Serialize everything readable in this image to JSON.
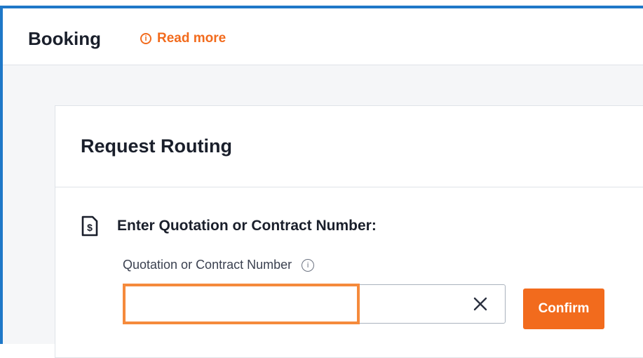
{
  "header": {
    "title": "Booking",
    "read_more_label": "Read more",
    "read_more_icon": "info-icon"
  },
  "card": {
    "title": "Request Routing",
    "section_icon": "document-dollar-icon",
    "section_label": "Enter Quotation or Contract Number:",
    "field": {
      "label": "Quotation or Contract Number",
      "info_icon": "info-icon",
      "value": "",
      "placeholder": "",
      "clear_icon": "close-icon"
    },
    "confirm_label": "Confirm"
  },
  "colors": {
    "accent": "#f26b1d",
    "highlight": "#f58a3c",
    "frame": "#1f78c8",
    "text": "#1a1f2b"
  }
}
